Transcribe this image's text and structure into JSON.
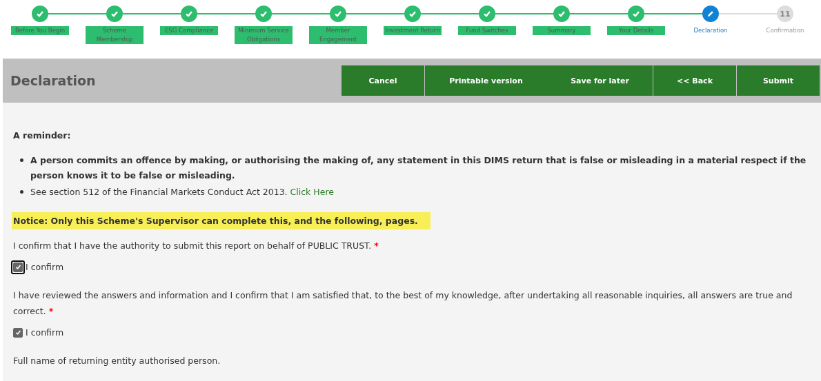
{
  "steps": [
    {
      "label": "Before You Begin",
      "kind": "done"
    },
    {
      "label": "Scheme Membership",
      "kind": "done"
    },
    {
      "label": "ESG Compliance",
      "kind": "done"
    },
    {
      "label": "Minimum Service Obligations",
      "kind": "done"
    },
    {
      "label": "Member Engagement",
      "kind": "done"
    },
    {
      "label": "Investment Return",
      "kind": "done"
    },
    {
      "label": "Fund Switches",
      "kind": "done"
    },
    {
      "label": "Summary",
      "kind": "done"
    },
    {
      "label": "Your Details",
      "kind": "done"
    },
    {
      "label": "Declaration",
      "kind": "current"
    },
    {
      "label": "Confirmation",
      "kind": "pending",
      "number": "11"
    }
  ],
  "header": {
    "title": "Declaration",
    "buttons": [
      {
        "label": "Cancel"
      },
      {
        "label": "Printable version"
      },
      {
        "label": "Save for later"
      },
      {
        "label": "<< Back"
      },
      {
        "label": "Submit"
      }
    ]
  },
  "reminder": {
    "heading": "A reminder:",
    "bullets": [
      {
        "text": "**A person commits an offence by making, or authorising the making of, any statement in this DIMS return that is false or misleading in a material respect if the person knows it to be false or misleading.**"
      },
      {
        "text": "See section 512 of the Financial Markets Conduct Act 2013.",
        "link": "Click Here"
      }
    ]
  },
  "notice": "Notice: Only this Scheme's Supervisor can complete this, and the following, pages.",
  "questions": [
    {
      "text": "I confirm that I have the authority to submit this report on behalf of PUBLIC TRUST.",
      "required": "*",
      "checkbox": {
        "label": "I confirm",
        "checked": true,
        "focused": true
      }
    },
    {
      "text": "I have reviewed the answers and information and I confirm that I am satisfied that, to the best of my knowledge, after undertaking all reasonable inquiries, all answers are true and correct.",
      "required": "*",
      "checkbox": {
        "label": "I confirm",
        "checked": true,
        "focused": false
      }
    }
  ],
  "final_label": "Full name of returning entity authorised person."
}
